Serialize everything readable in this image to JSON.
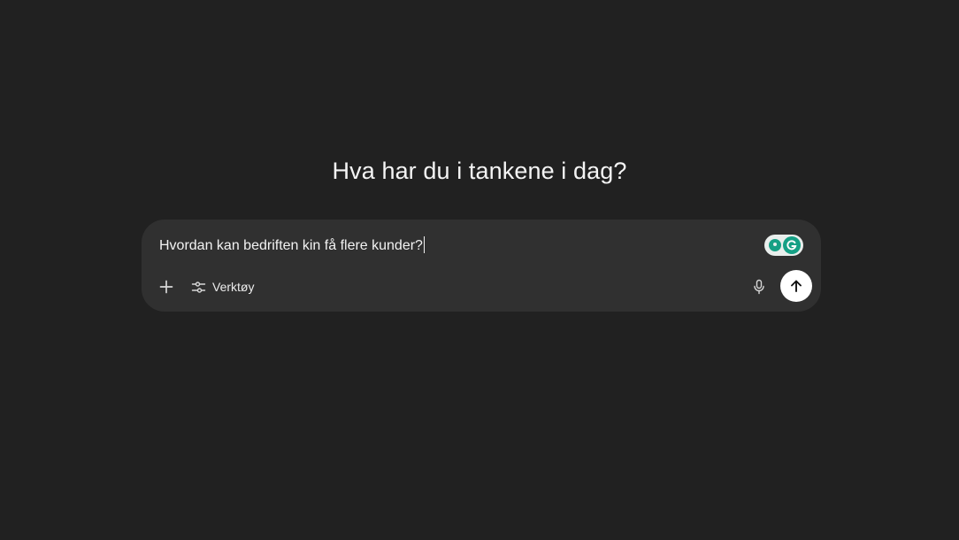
{
  "main": {
    "heading": "Hva har du i tankene i dag?"
  },
  "composer": {
    "input_value": "Hvordan kan bedriften kin få flere kunder?",
    "tools_label": "Verktøy",
    "icons": {
      "attach": "plus-icon",
      "tools": "sliders-icon",
      "dictate": "microphone-icon",
      "send": "arrow-up-icon",
      "extension": "grammarly-icon"
    }
  },
  "colors": {
    "background": "#212121",
    "composer_background": "#303030",
    "send_button": "#ffffff",
    "grammarly_green": "#15a085"
  }
}
